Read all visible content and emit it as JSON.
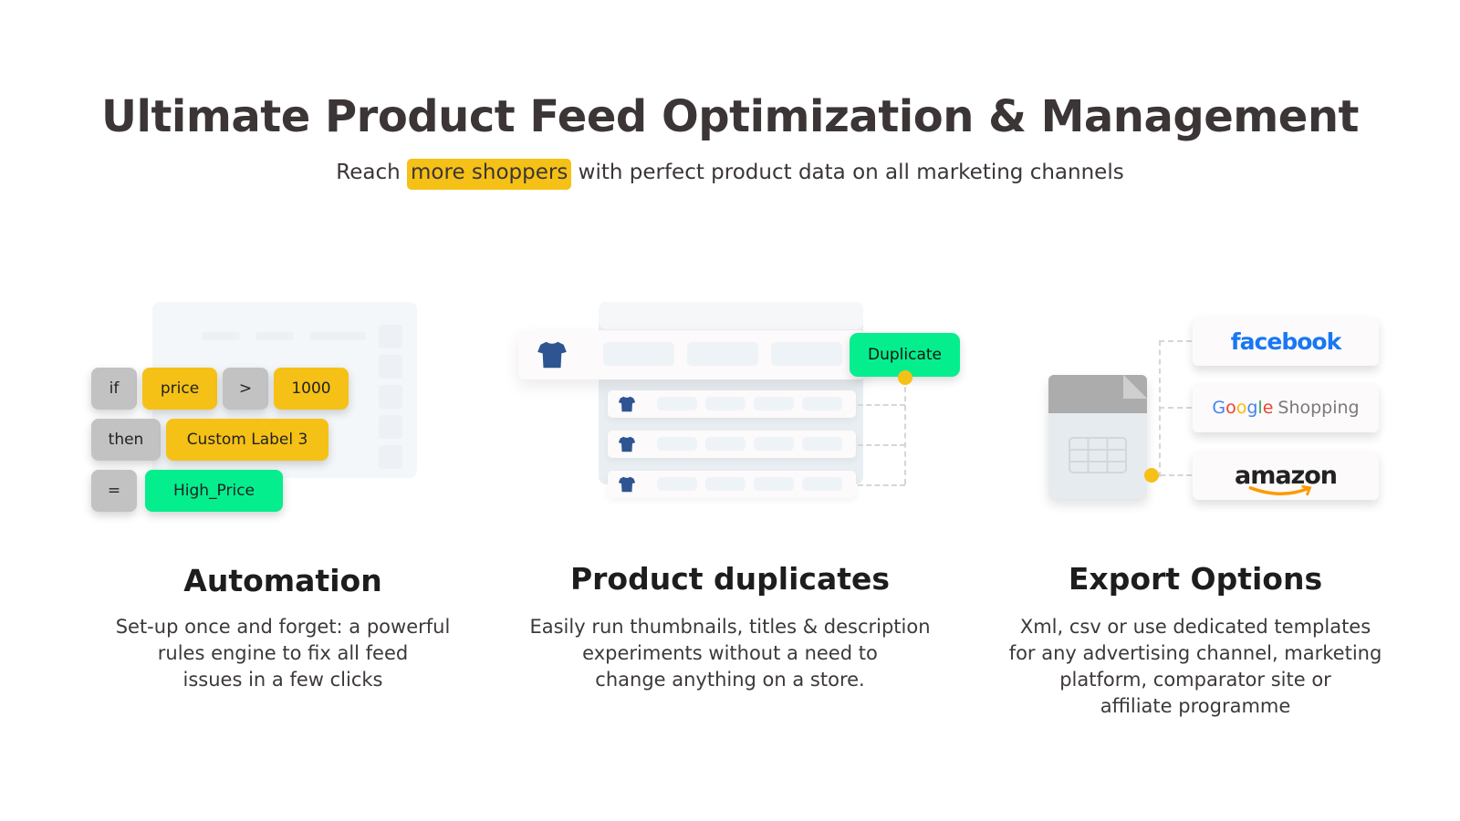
{
  "header": {
    "title": "Ultimate Product Feed Optimization & Management",
    "subtitle_before": "Reach",
    "subtitle_highlight": "more shoppers",
    "subtitle_after": "with perfect product data on all marketing channels"
  },
  "colors": {
    "accent_yellow": "#f5c116",
    "accent_green": "#04ee8e",
    "chip_gray": "#c2c2c2",
    "facebook_blue": "#1877f2",
    "amazon_orange": "#ff9900"
  },
  "automation": {
    "rule": {
      "if_label": "if",
      "field": "price",
      "operator": ">",
      "value": "1000",
      "then_label": "then",
      "target": "Custom Label 3",
      "equals_label": "=",
      "result": "High_Price"
    },
    "title": "Automation",
    "description_lines": [
      "Set-up once and forget: a powerful",
      "rules engine to fix all feed",
      "issues in a few clicks"
    ]
  },
  "duplicates": {
    "button_label": "Duplicate",
    "icon": "tshirt-icon",
    "title": "Product duplicates",
    "description_lines": [
      "Easily run thumbnails, titles & description",
      "experiments without a need to",
      "change anything on a store."
    ]
  },
  "export": {
    "icon": "spreadsheet-file-icon",
    "channels": [
      {
        "name": "facebook"
      },
      {
        "name_google": "Google",
        "name_suffix": "Shopping"
      },
      {
        "name": "amazon"
      }
    ],
    "title": "Export Options",
    "description_lines": [
      "Xml, csv or use dedicated templates",
      "for any advertising channel, marketing",
      "platform, comparator site or",
      "affiliate programme"
    ]
  }
}
